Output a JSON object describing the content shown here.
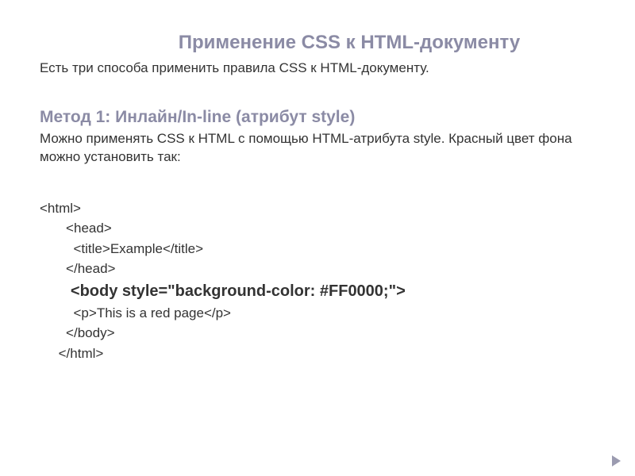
{
  "title": "Применение CSS к HTML-документу",
  "intro": "Есть три способа применить правила CSS к HTML-документу.",
  "method": {
    "title": "Метод 1: Инлайн/In-line (атрибут style)",
    "description": "Можно применять CSS к HTML с помощью HTML-атрибута style. Красный цвет фона можно установить так:"
  },
  "code": {
    "line1": "<html>",
    "line2": "       <head>",
    "line3": "         <title>Example</title>",
    "line4": "       </head>",
    "line5": "       <body style=\"background-color: #FF0000;\">",
    "line6": "         <p>This is a red page</p>",
    "line7": "       </body>",
    "line8": "     </html>"
  }
}
